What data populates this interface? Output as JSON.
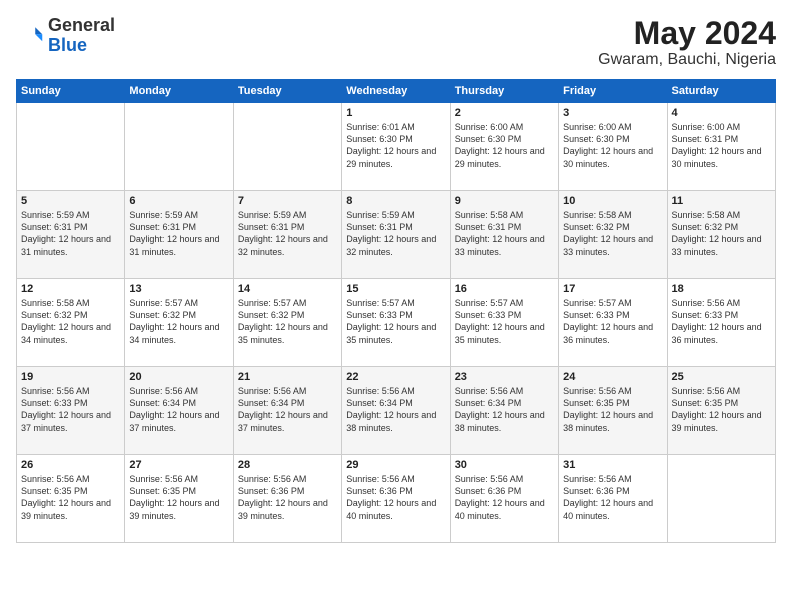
{
  "header": {
    "logo_line1": "General",
    "logo_line2": "Blue",
    "month_year": "May 2024",
    "location": "Gwaram, Bauchi, Nigeria"
  },
  "days_of_week": [
    "Sunday",
    "Monday",
    "Tuesday",
    "Wednesday",
    "Thursday",
    "Friday",
    "Saturday"
  ],
  "weeks": [
    [
      {
        "day": "",
        "content": ""
      },
      {
        "day": "",
        "content": ""
      },
      {
        "day": "",
        "content": ""
      },
      {
        "day": "1",
        "content": "Sunrise: 6:01 AM\nSunset: 6:30 PM\nDaylight: 12 hours and 29 minutes."
      },
      {
        "day": "2",
        "content": "Sunrise: 6:00 AM\nSunset: 6:30 PM\nDaylight: 12 hours and 29 minutes."
      },
      {
        "day": "3",
        "content": "Sunrise: 6:00 AM\nSunset: 6:30 PM\nDaylight: 12 hours and 30 minutes."
      },
      {
        "day": "4",
        "content": "Sunrise: 6:00 AM\nSunset: 6:31 PM\nDaylight: 12 hours and 30 minutes."
      }
    ],
    [
      {
        "day": "5",
        "content": "Sunrise: 5:59 AM\nSunset: 6:31 PM\nDaylight: 12 hours and 31 minutes."
      },
      {
        "day": "6",
        "content": "Sunrise: 5:59 AM\nSunset: 6:31 PM\nDaylight: 12 hours and 31 minutes."
      },
      {
        "day": "7",
        "content": "Sunrise: 5:59 AM\nSunset: 6:31 PM\nDaylight: 12 hours and 32 minutes."
      },
      {
        "day": "8",
        "content": "Sunrise: 5:59 AM\nSunset: 6:31 PM\nDaylight: 12 hours and 32 minutes."
      },
      {
        "day": "9",
        "content": "Sunrise: 5:58 AM\nSunset: 6:31 PM\nDaylight: 12 hours and 33 minutes."
      },
      {
        "day": "10",
        "content": "Sunrise: 5:58 AM\nSunset: 6:32 PM\nDaylight: 12 hours and 33 minutes."
      },
      {
        "day": "11",
        "content": "Sunrise: 5:58 AM\nSunset: 6:32 PM\nDaylight: 12 hours and 33 minutes."
      }
    ],
    [
      {
        "day": "12",
        "content": "Sunrise: 5:58 AM\nSunset: 6:32 PM\nDaylight: 12 hours and 34 minutes."
      },
      {
        "day": "13",
        "content": "Sunrise: 5:57 AM\nSunset: 6:32 PM\nDaylight: 12 hours and 34 minutes."
      },
      {
        "day": "14",
        "content": "Sunrise: 5:57 AM\nSunset: 6:32 PM\nDaylight: 12 hours and 35 minutes."
      },
      {
        "day": "15",
        "content": "Sunrise: 5:57 AM\nSunset: 6:33 PM\nDaylight: 12 hours and 35 minutes."
      },
      {
        "day": "16",
        "content": "Sunrise: 5:57 AM\nSunset: 6:33 PM\nDaylight: 12 hours and 35 minutes."
      },
      {
        "day": "17",
        "content": "Sunrise: 5:57 AM\nSunset: 6:33 PM\nDaylight: 12 hours and 36 minutes."
      },
      {
        "day": "18",
        "content": "Sunrise: 5:56 AM\nSunset: 6:33 PM\nDaylight: 12 hours and 36 minutes."
      }
    ],
    [
      {
        "day": "19",
        "content": "Sunrise: 5:56 AM\nSunset: 6:33 PM\nDaylight: 12 hours and 37 minutes."
      },
      {
        "day": "20",
        "content": "Sunrise: 5:56 AM\nSunset: 6:34 PM\nDaylight: 12 hours and 37 minutes."
      },
      {
        "day": "21",
        "content": "Sunrise: 5:56 AM\nSunset: 6:34 PM\nDaylight: 12 hours and 37 minutes."
      },
      {
        "day": "22",
        "content": "Sunrise: 5:56 AM\nSunset: 6:34 PM\nDaylight: 12 hours and 38 minutes."
      },
      {
        "day": "23",
        "content": "Sunrise: 5:56 AM\nSunset: 6:34 PM\nDaylight: 12 hours and 38 minutes."
      },
      {
        "day": "24",
        "content": "Sunrise: 5:56 AM\nSunset: 6:35 PM\nDaylight: 12 hours and 38 minutes."
      },
      {
        "day": "25",
        "content": "Sunrise: 5:56 AM\nSunset: 6:35 PM\nDaylight: 12 hours and 39 minutes."
      }
    ],
    [
      {
        "day": "26",
        "content": "Sunrise: 5:56 AM\nSunset: 6:35 PM\nDaylight: 12 hours and 39 minutes."
      },
      {
        "day": "27",
        "content": "Sunrise: 5:56 AM\nSunset: 6:35 PM\nDaylight: 12 hours and 39 minutes."
      },
      {
        "day": "28",
        "content": "Sunrise: 5:56 AM\nSunset: 6:36 PM\nDaylight: 12 hours and 39 minutes."
      },
      {
        "day": "29",
        "content": "Sunrise: 5:56 AM\nSunset: 6:36 PM\nDaylight: 12 hours and 40 minutes."
      },
      {
        "day": "30",
        "content": "Sunrise: 5:56 AM\nSunset: 6:36 PM\nDaylight: 12 hours and 40 minutes."
      },
      {
        "day": "31",
        "content": "Sunrise: 5:56 AM\nSunset: 6:36 PM\nDaylight: 12 hours and 40 minutes."
      },
      {
        "day": "",
        "content": ""
      }
    ]
  ]
}
